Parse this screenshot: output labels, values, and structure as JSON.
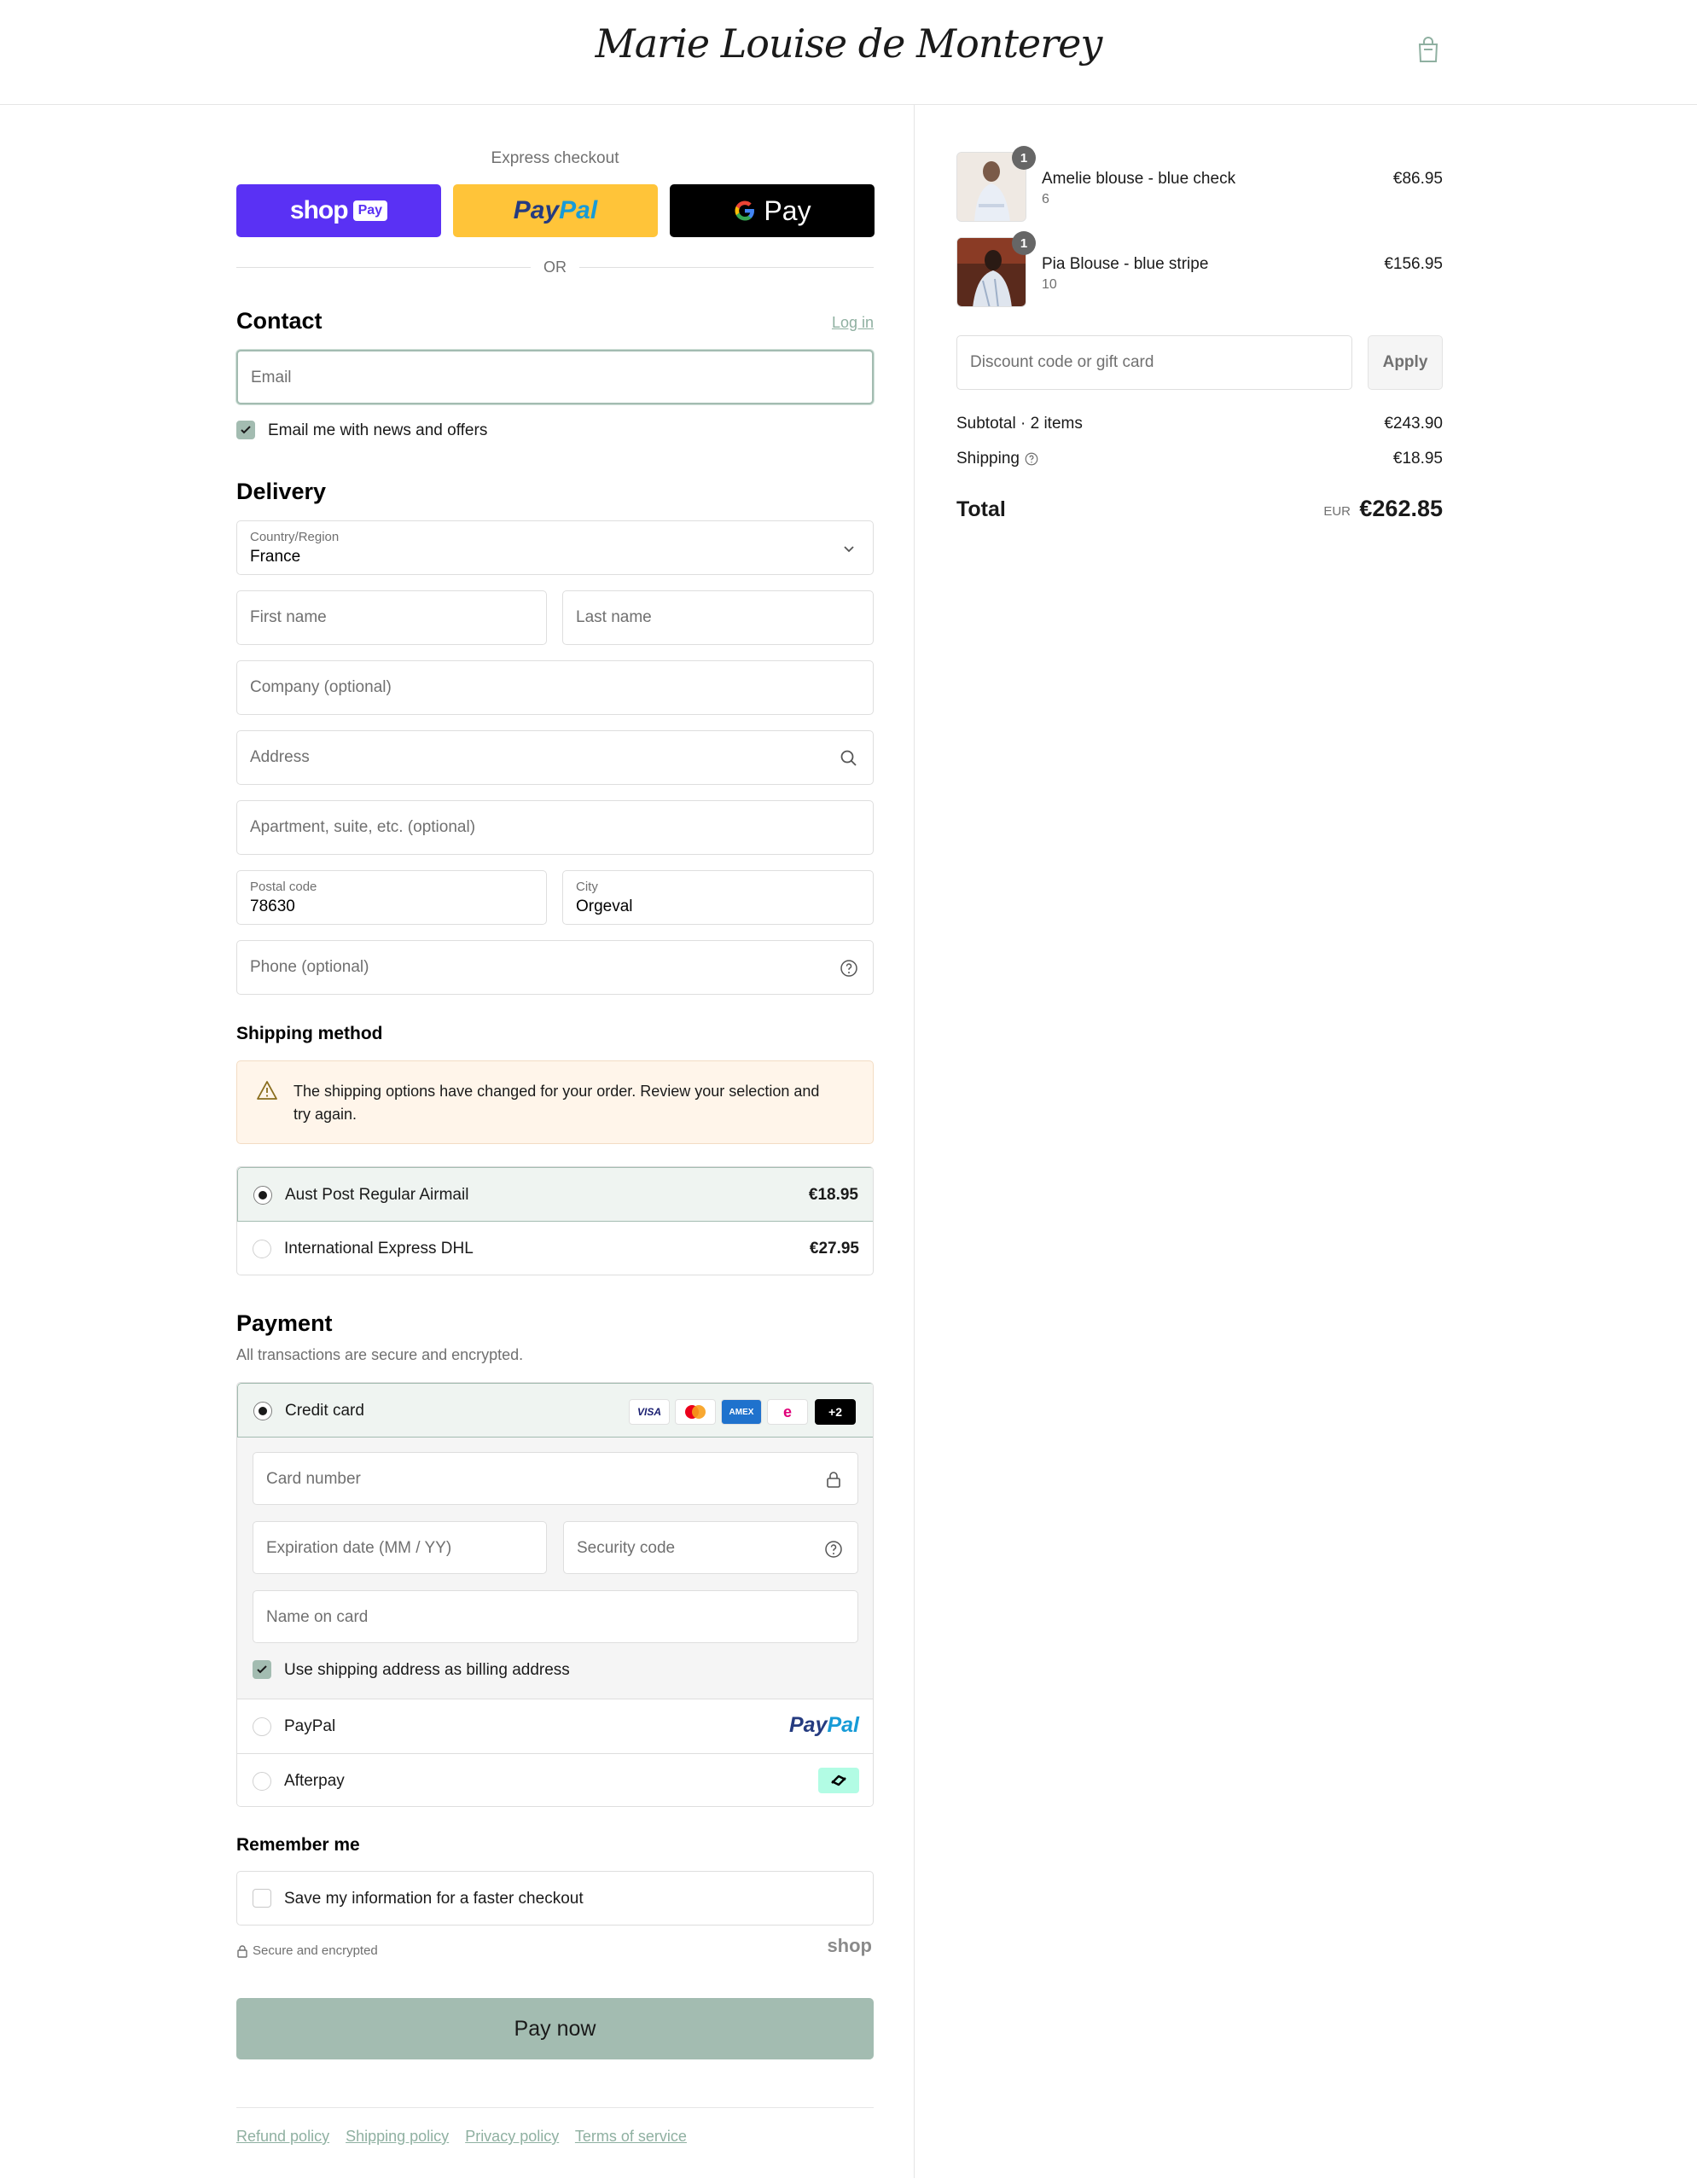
{
  "header": {
    "logo": "Marie Louise de Monterey"
  },
  "express": {
    "title": "Express checkout",
    "shop_word": "shop",
    "shop_chip": "Pay",
    "paypal_a": "Pay",
    "paypal_b": "Pal",
    "gpay_word": "Pay",
    "or": "OR"
  },
  "contact": {
    "heading": "Contact",
    "login": "Log in",
    "email_placeholder": "Email",
    "news_label": "Email me with news and offers",
    "news_checked": true
  },
  "delivery": {
    "heading": "Delivery",
    "country_label": "Country/Region",
    "country_value": "France",
    "first_name": "First name",
    "last_name": "Last name",
    "company": "Company (optional)",
    "address": "Address",
    "apartment": "Apartment, suite, etc. (optional)",
    "postal_label": "Postal code",
    "postal_value": "78630",
    "city_label": "City",
    "city_value": "Orgeval",
    "phone": "Phone (optional)"
  },
  "shipping": {
    "heading": "Shipping method",
    "warning": "The shipping options have changed for your order. Review your selection and try again.",
    "options": [
      {
        "label": "Aust Post Regular Airmail",
        "price": "€18.95",
        "selected": true
      },
      {
        "label": "International Express DHL",
        "price": "€27.95",
        "selected": false
      }
    ]
  },
  "payment": {
    "heading": "Payment",
    "subtitle": "All transactions are secure and encrypted.",
    "credit_card": "Credit card",
    "brands": [
      "VISA",
      "mastercard",
      "AMEX",
      "e",
      "+2"
    ],
    "card_number": "Card number",
    "expiry": "Expiration date (MM / YY)",
    "security": "Security code",
    "name_on_card": "Name on card",
    "billing_label": "Use shipping address as billing address",
    "paypal": "PayPal",
    "paypal_logo_a": "Pay",
    "paypal_logo_b": "Pal",
    "afterpay": "Afterpay"
  },
  "remember": {
    "heading": "Remember me",
    "save_label": "Save my information for a faster checkout",
    "secure": "Secure and encrypted",
    "shop_brand": "shop"
  },
  "pay_now": "Pay now",
  "footer": [
    "Refund policy",
    "Shipping policy",
    "Privacy policy",
    "Terms of service"
  ],
  "order": {
    "items": [
      {
        "name": "Amelie blouse - blue check",
        "variant": "6",
        "price": "€86.95",
        "qty": "1"
      },
      {
        "name": "Pia Blouse - blue stripe",
        "variant": "10",
        "price": "€156.95",
        "qty": "1"
      }
    ],
    "discount_placeholder": "Discount code or gift card",
    "apply": "Apply",
    "subtotal_label": "Subtotal · 2 items",
    "subtotal": "€243.90",
    "shipping_label": "Shipping",
    "shipping": "€18.95",
    "total_label": "Total",
    "currency": "EUR",
    "total": "€262.85"
  },
  "colors": {
    "accent": "#a3bcb1",
    "shop_purple": "#5a31f4",
    "paypal_yellow": "#ffc439"
  }
}
